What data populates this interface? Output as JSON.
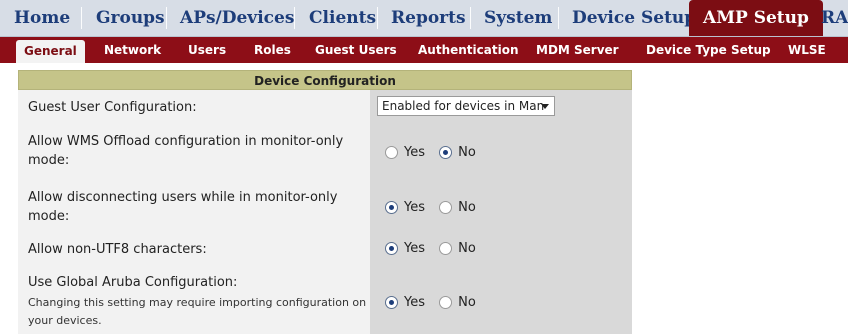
{
  "top_nav": {
    "items": [
      "Home",
      "Groups",
      "APs/Devices",
      "Clients",
      "Reports",
      "System",
      "Device Setup",
      "AMP Setup",
      "RAF"
    ],
    "active": "AMP Setup"
  },
  "sub_nav": {
    "items": [
      "General",
      "Network",
      "Users",
      "Roles",
      "Guest Users",
      "Authentication",
      "MDM Server",
      "Device Type Setup",
      "WLSE"
    ],
    "active": "General"
  },
  "section": {
    "title": "Device Configuration"
  },
  "rows": [
    {
      "label": "Guest User Configuration:",
      "control": "select",
      "value": "Enabled for devices in Man"
    },
    {
      "label": "Allow WMS Offload configuration in monitor-only mode:",
      "control": "radio",
      "options": [
        "Yes",
        "No"
      ],
      "selected": "No"
    },
    {
      "label": "Allow disconnecting users while in monitor-only mode:",
      "control": "radio",
      "options": [
        "Yes",
        "No"
      ],
      "selected": "Yes"
    },
    {
      "label": "Allow non-UTF8 characters:",
      "control": "radio",
      "options": [
        "Yes",
        "No"
      ],
      "selected": "Yes"
    },
    {
      "label": "Use Global Aruba Configuration:",
      "hint": "Changing this setting may require importing configuration on your devices.",
      "control": "radio",
      "options": [
        "Yes",
        "No"
      ],
      "selected": "Yes"
    }
  ],
  "colors": {
    "nav_bg": "#d7dde6",
    "nav_text": "#1d3d7a",
    "accent": "#8d0e17",
    "header_bg": "#c5c489"
  }
}
